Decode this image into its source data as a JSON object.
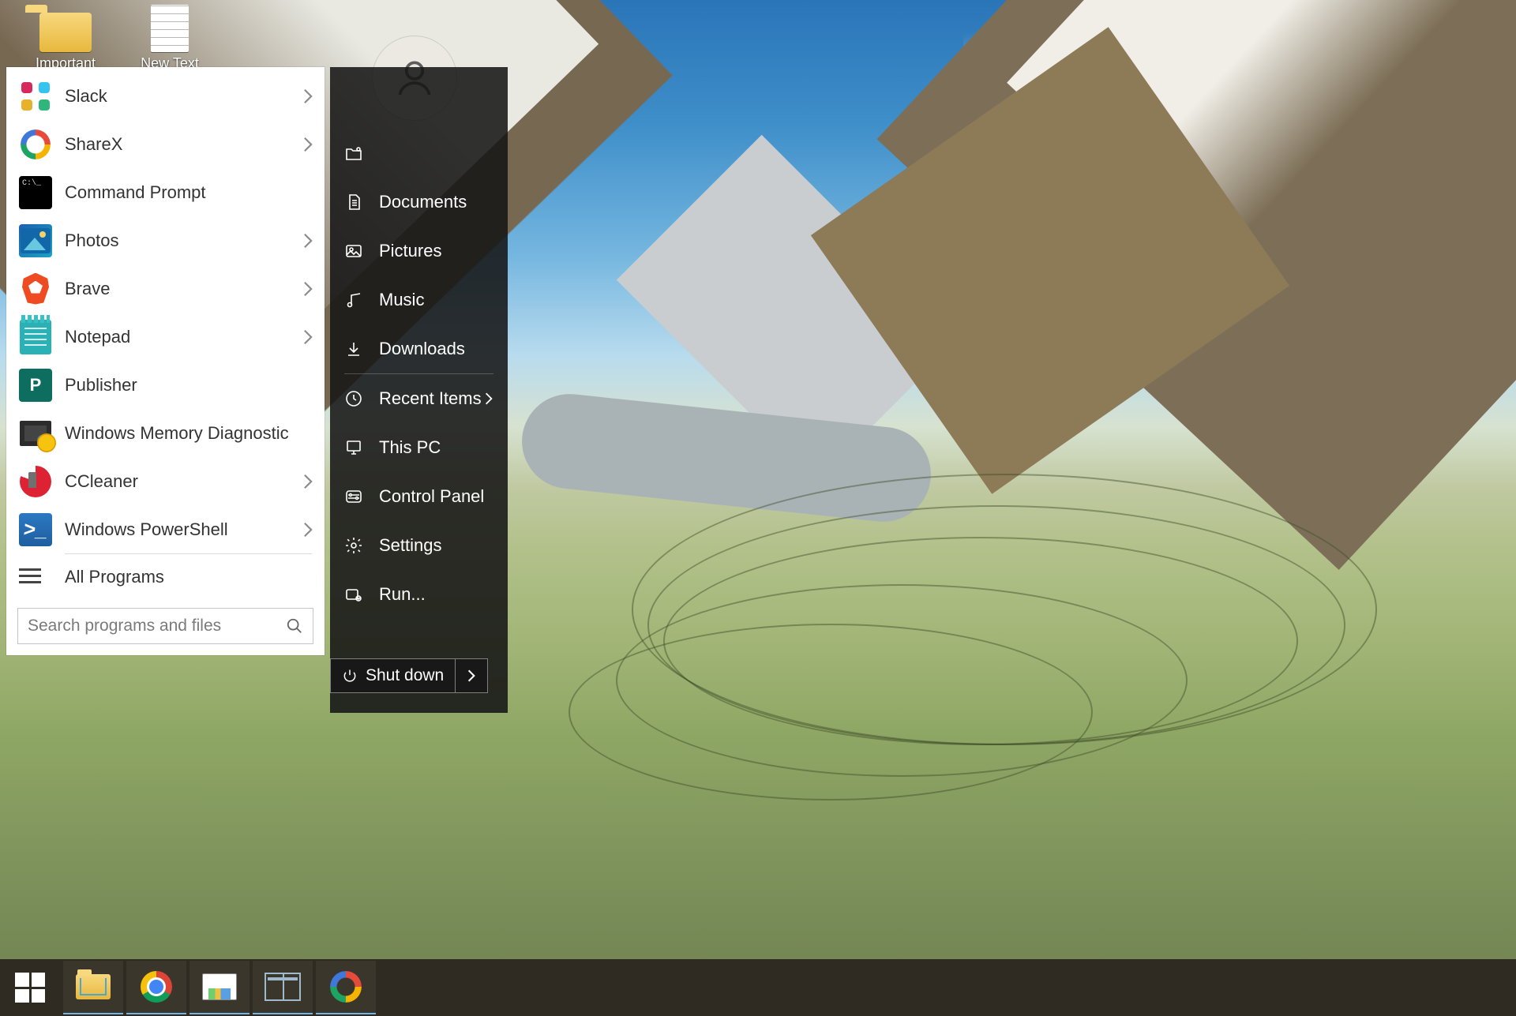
{
  "desktop": {
    "icons": [
      {
        "id": "important",
        "label": "Important"
      },
      {
        "id": "newtext",
        "label": "New Text"
      }
    ]
  },
  "start_menu": {
    "items": [
      {
        "id": "slack",
        "label": "Slack",
        "submenu": true
      },
      {
        "id": "sharex",
        "label": "ShareX",
        "submenu": true
      },
      {
        "id": "cmd",
        "label": "Command Prompt",
        "submenu": false
      },
      {
        "id": "photos",
        "label": "Photos",
        "submenu": true
      },
      {
        "id": "brave",
        "label": "Brave",
        "submenu": true
      },
      {
        "id": "notepad",
        "label": "Notepad",
        "submenu": true
      },
      {
        "id": "publisher",
        "label": "Publisher",
        "submenu": false
      },
      {
        "id": "memdiag",
        "label": "Windows Memory Diagnostic",
        "submenu": false
      },
      {
        "id": "ccleaner",
        "label": "CCleaner",
        "submenu": true
      },
      {
        "id": "powershell",
        "label": "Windows PowerShell",
        "submenu": true
      }
    ],
    "all_programs_label": "All Programs",
    "search_placeholder": "Search programs and files"
  },
  "side_panel": {
    "items": [
      {
        "id": "user",
        "label": "",
        "icon": "user-folder-icon"
      },
      {
        "id": "documents",
        "label": "Documents",
        "icon": "document-icon"
      },
      {
        "id": "pictures",
        "label": "Pictures",
        "icon": "picture-icon"
      },
      {
        "id": "music",
        "label": "Music",
        "icon": "music-icon"
      },
      {
        "id": "downloads",
        "label": "Downloads",
        "icon": "download-icon"
      },
      {
        "id": "recent",
        "label": "Recent Items",
        "icon": "clock-icon",
        "submenu": true
      },
      {
        "id": "thispc",
        "label": "This PC",
        "icon": "pc-icon"
      },
      {
        "id": "cpanel",
        "label": "Control Panel",
        "icon": "controls-icon"
      },
      {
        "id": "settings",
        "label": "Settings",
        "icon": "gear-icon"
      },
      {
        "id": "run",
        "label": "Run...",
        "icon": "run-icon"
      }
    ],
    "shutdown_label": "Shut down"
  },
  "taskbar": {
    "buttons": [
      {
        "id": "start",
        "icon": "windows-icon"
      },
      {
        "id": "explorer",
        "icon": "folder-icon"
      },
      {
        "id": "chrome",
        "icon": "chrome-icon"
      },
      {
        "id": "taskmgr",
        "icon": "monitor-icon"
      },
      {
        "id": "startmenucfg",
        "icon": "start-layout-icon"
      },
      {
        "id": "sharex",
        "icon": "sharex-icon"
      }
    ]
  }
}
